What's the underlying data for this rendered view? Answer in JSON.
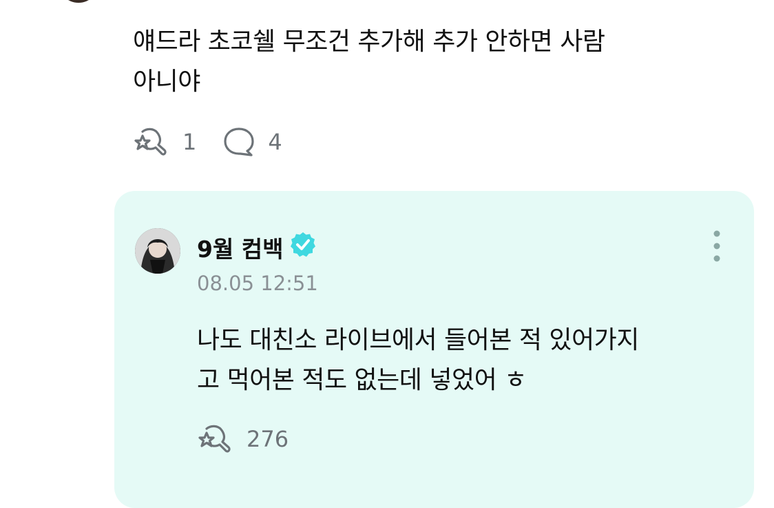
{
  "post": {
    "text_line1": "얘드라 초코쉘 무조건 추가해 추가 안하면 사람",
    "text_line2": "아니야",
    "like_count": "1",
    "reply_count": "4"
  },
  "reply": {
    "author": "9월 컴백",
    "timestamp": "08.05 12:51",
    "text_line1": "나도 대친소 라이브에서 들어본 적 있어가지",
    "text_line2": "고 먹어본 적도 없는데 넣었어 ㅎ",
    "like_count": "276"
  },
  "icons": {
    "like": "star-hand-like-icon",
    "comment": "speech-bubble-icon",
    "verified": "verified-badge-icon",
    "more": "more-vertical-icon"
  },
  "colors": {
    "card_background": "#e5faf6",
    "verified_badge": "#3fd8e0",
    "muted_text": "#8a9095",
    "icon_gray": "#6d7378"
  }
}
